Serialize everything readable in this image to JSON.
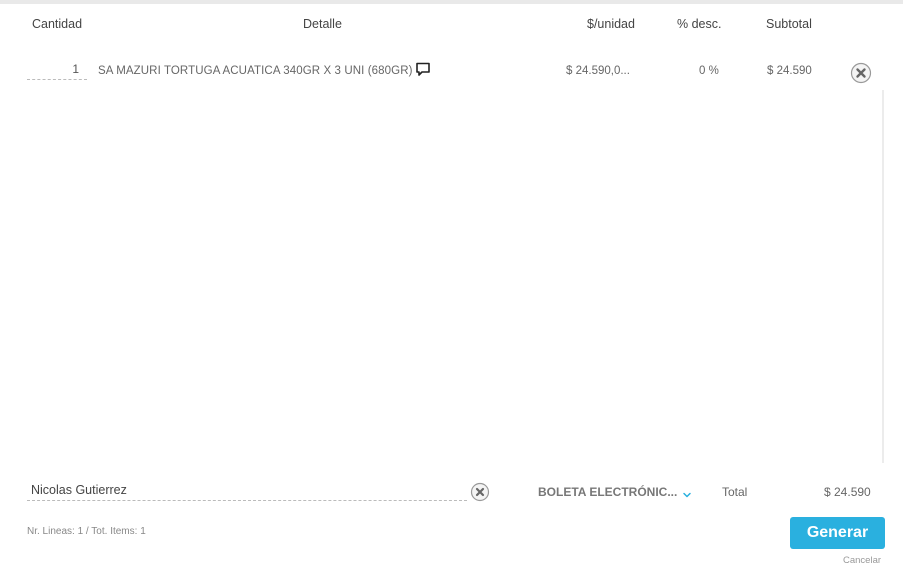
{
  "table": {
    "columns": {
      "cantidad": "Cantidad",
      "detalle": "Detalle",
      "unit_price": "$/unidad",
      "discount": "% desc.",
      "subtotal": "Subtotal"
    },
    "rows": [
      {
        "quantity": "1",
        "detail": "SA MAZURI TORTUGA ACUATICA 340GR X 3 UNI (680GR)",
        "unit_price": "$ 24.590,0...",
        "discount": "0 %",
        "subtotal": "$ 24.590"
      }
    ]
  },
  "footer": {
    "customer_name": "Nicolas Gutierrez",
    "document_type": "BOLETA ELECTRÓNIC...",
    "total_label": "Total",
    "total_value": "$ 24.590",
    "counts": "Nr. Lineas: 1 / Tot. Items: 1",
    "generate_label": "Generar",
    "cancel_label": "Cancelar"
  },
  "colors": {
    "accent": "#2ab0df",
    "chevron": "#2ab0df"
  },
  "icons": {
    "comment": "comment-icon",
    "remove": "close-circle-icon",
    "clear": "close-circle-icon",
    "dropdown": "chevron-down-icon"
  }
}
